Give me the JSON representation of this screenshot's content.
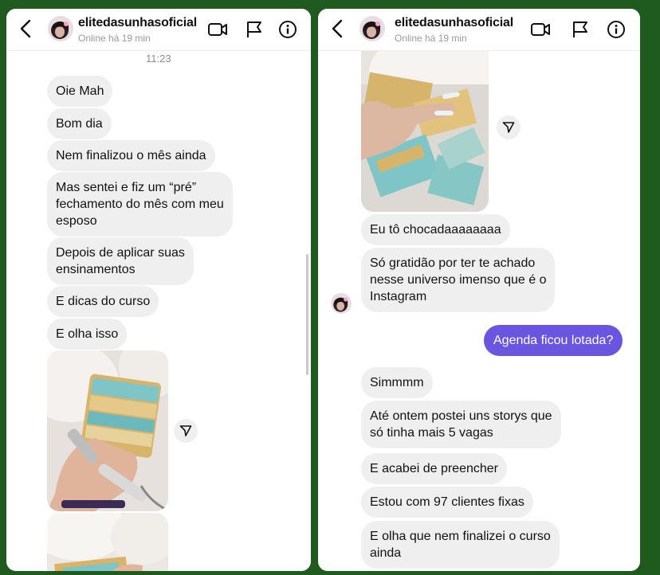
{
  "conversation": {
    "username": "elitedasunhasoficial",
    "status": "Online há 19 min"
  },
  "icons": {
    "back": "chevron-left-icon",
    "video": "video-camera-icon",
    "flag": "flag-icon",
    "info": "info-icon",
    "share": "send-icon"
  },
  "colors": {
    "background": "#1f5a1f",
    "incoming_bubble": "#efefef",
    "outgoing_bubble": "#6a55e0"
  },
  "left_thread": {
    "timestamp": "11:23",
    "messages": [
      "Oie Mah",
      "Bom dia",
      "Nem finalizou o mês ainda",
      "Mas sentei e fiz um “pré”\nfechamento do mês com meu\nesposo",
      "Depois de aplicar suas\nensinamentos",
      "E dicas do curso",
      "E olha isso"
    ]
  },
  "right_thread": {
    "incoming_1": [
      "Eu tô chocadaaaaaaaa",
      "Só gratidão por ter te achado\nnesse universo imenso que é o\nInstagram"
    ],
    "outgoing": "Agenda ficou lotada?",
    "incoming_2": [
      "Simmmm",
      "Até ontem postei uns storys que\nsó tinha mais 5 vagas",
      "E acabei de preencher",
      "Estou com 97 clientes fixas",
      "E olha que nem finalizei o curso\nainda"
    ]
  }
}
